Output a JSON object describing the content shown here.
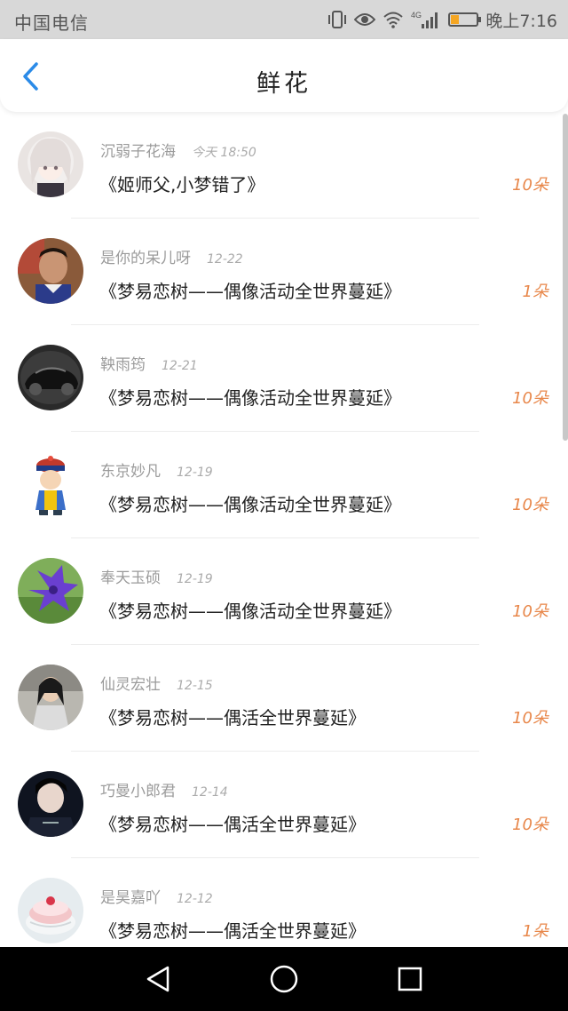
{
  "status_bar": {
    "carrier": "中国电信",
    "time": "晚上7:16",
    "icons": [
      "vibrate-icon",
      "eye-icon",
      "wifi-icon",
      "4g-signal-icon",
      "battery-icon"
    ],
    "network_label": "4G",
    "battery_level": 0.3,
    "battery_color": "#f5a623"
  },
  "header": {
    "title": "鲜花",
    "back_icon": "chevron-left-icon",
    "accent_color": "#2b8be8"
  },
  "list": {
    "items": [
      {
        "user": "沉弱子花海",
        "date": "今天 18:50",
        "message": "《姬师父,小梦错了》",
        "flowers": "10朵",
        "avatar": "anime-girl"
      },
      {
        "user": "是你的呆儿呀",
        "date": "12-22",
        "message": "《梦易恋树——偶像活动全世界蔓延》",
        "flowers": "1朵",
        "avatar": "boy-photo"
      },
      {
        "user": "鞅雨筠",
        "date": "12-21",
        "message": "《梦易恋树——偶像活动全世界蔓延》",
        "flowers": "10朵",
        "avatar": "sports-car"
      },
      {
        "user": "东京妙凡",
        "date": "12-19",
        "message": "《梦易恋树——偶像活动全世界蔓延》",
        "flowers": "10朵",
        "avatar": "qing-official-cartoon"
      },
      {
        "user": "奉天玉硕",
        "date": "12-19",
        "message": "《梦易恋树——偶像活动全世界蔓延》",
        "flowers": "10朵",
        "avatar": "purple-flower"
      },
      {
        "user": "仙灵宏壮",
        "date": "12-15",
        "message": "《梦易恋树——偶活全世界蔓延》",
        "flowers": "10朵",
        "avatar": "girl-photo"
      },
      {
        "user": "巧曼小郎君",
        "date": "12-14",
        "message": "《梦易恋树——偶活全世界蔓延》",
        "flowers": "10朵",
        "avatar": "boy-dark-photo"
      },
      {
        "user": "是昊嘉吖",
        "date": "12-12",
        "message": "《梦易恋树——偶活全世界蔓延》",
        "flowers": "1朵",
        "avatar": "cake"
      }
    ],
    "flower_color": "#e8874a"
  },
  "nav_bar": {
    "buttons": [
      "back-triangle-icon",
      "home-circle-icon",
      "recents-square-icon"
    ]
  }
}
